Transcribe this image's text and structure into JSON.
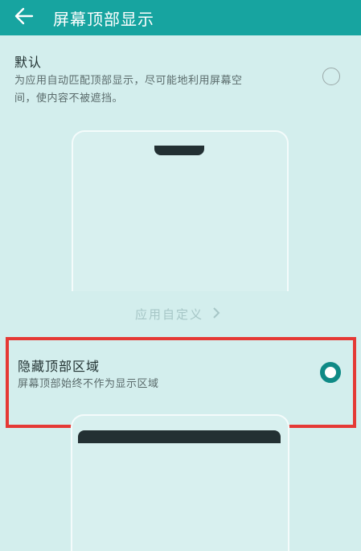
{
  "appbar": {
    "title": "屏幕顶部显示",
    "back_icon": "arrow-left-icon"
  },
  "options": [
    {
      "title": "默认",
      "desc_line1": "为应用自动匹配顶部显示，尽可能地利用屏幕空",
      "desc_line2": "间，使内容不被遮挡。",
      "selected": false
    },
    {
      "title": "隐藏顶部区域",
      "desc": "屏幕顶部始终不作为显示区域",
      "selected": true
    }
  ],
  "customize_link": "应用自定义",
  "colors": {
    "header": "#17a4a0",
    "background": "#d3eeed",
    "radio_active": "#0f8a86",
    "highlight": "#e53935"
  }
}
